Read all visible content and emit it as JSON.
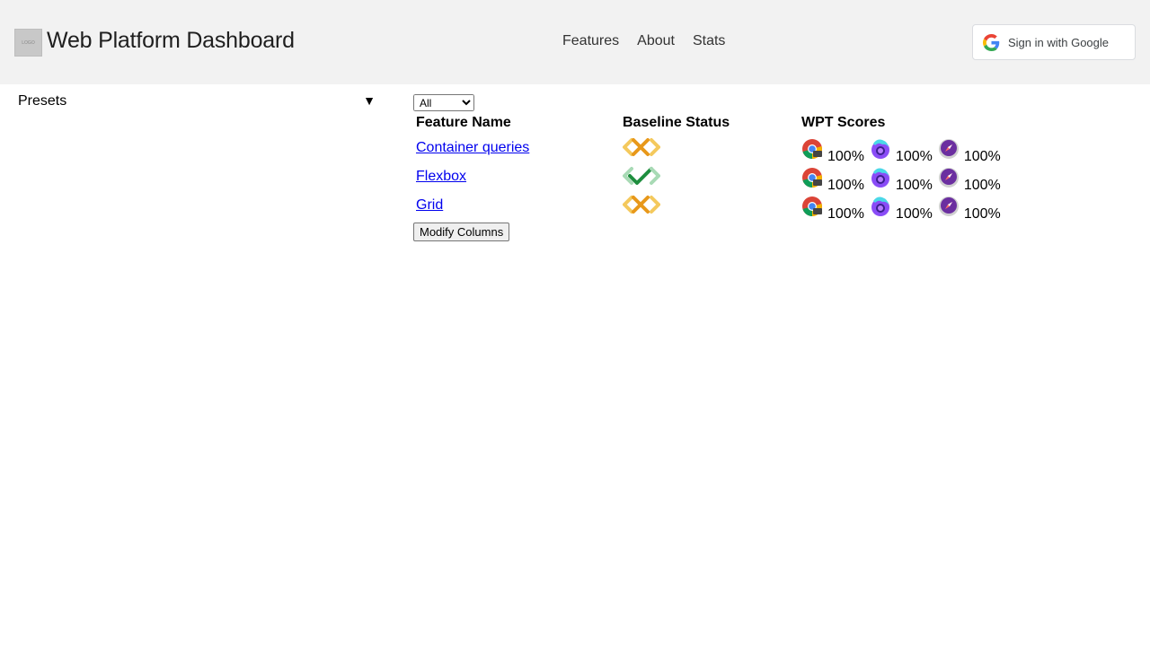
{
  "header": {
    "logo_text": "LOGO",
    "title": "Web Platform Dashboard",
    "nav": [
      "Features",
      "About",
      "Stats"
    ],
    "signin_label": "Sign in with Google"
  },
  "sidebar": {
    "presets_label": "Presets",
    "presets_arrow": "▼"
  },
  "main": {
    "filter": {
      "selected": "All",
      "options": [
        "All"
      ]
    },
    "columns": [
      "Feature Name",
      "Baseline Status",
      "WPT Scores"
    ],
    "rows": [
      {
        "name": "Container queries",
        "baseline": "limited",
        "scores": [
          "100%",
          "100%",
          "100%"
        ]
      },
      {
        "name": "Flexbox",
        "baseline": "widely",
        "scores": [
          "100%",
          "100%",
          "100%"
        ]
      },
      {
        "name": "Grid",
        "baseline": "limited",
        "scores": [
          "100%",
          "100%",
          "100%"
        ]
      }
    ],
    "browsers": [
      "chrome-icon",
      "firefox-icon",
      "safari-icon"
    ],
    "modify_label": "Modify Columns"
  },
  "colors": {
    "header_bg": "#f2f2f2",
    "link": "#0000ee",
    "baseline_limited": "#e8981a",
    "baseline_widely": "#1e8e3e"
  }
}
